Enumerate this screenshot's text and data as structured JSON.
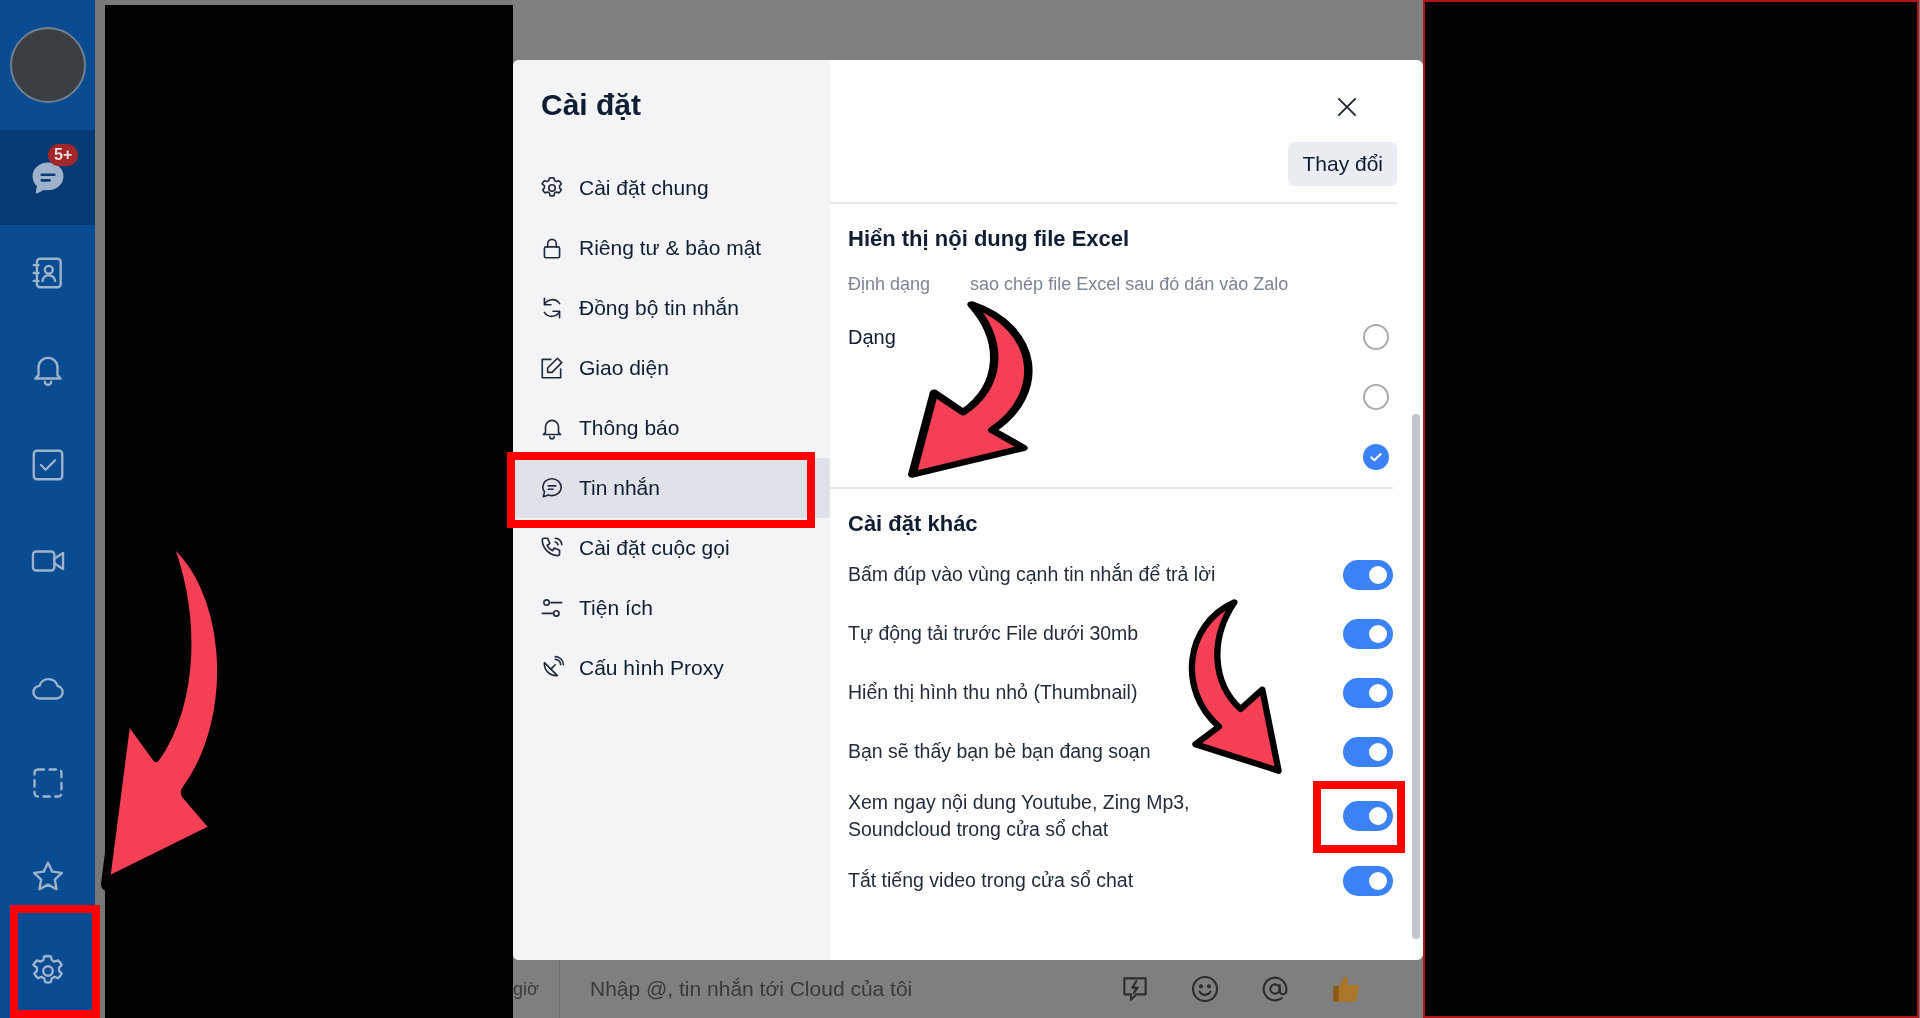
{
  "nav": {
    "badge": "5+",
    "items": [
      {
        "kind": "chat",
        "selected": true
      },
      {
        "kind": "contacts",
        "selected": false
      },
      {
        "kind": "bell",
        "selected": false
      },
      {
        "kind": "todo",
        "selected": false
      },
      {
        "kind": "video",
        "selected": false
      }
    ],
    "bottom_items": [
      {
        "kind": "cloud",
        "selected": false
      },
      {
        "kind": "dashed",
        "selected": false
      },
      {
        "kind": "star",
        "selected": false
      },
      {
        "kind": "gear",
        "selected": false
      }
    ]
  },
  "chat": {
    "time_fragment": "giờ",
    "composer_placeholder": "Nhập @, tin nhắn tới Cloud của tôi"
  },
  "settings": {
    "title": "Cài đặt",
    "menu": [
      {
        "label": "Cài đặt chung",
        "kind": "gear",
        "selected": false
      },
      {
        "label": "Riêng tư & bảo mật",
        "kind": "lock",
        "selected": false
      },
      {
        "label": "Đồng bộ tin nhắn",
        "kind": "sync",
        "selected": false
      },
      {
        "label": "Giao diện",
        "kind": "edit",
        "selected": false
      },
      {
        "label": "Thông báo",
        "kind": "bell",
        "selected": false
      },
      {
        "label": "Tin nhắn",
        "kind": "chat",
        "selected": true
      },
      {
        "label": "Cài đặt cuộc gọi",
        "kind": "phone",
        "selected": false
      },
      {
        "label": "Tiện ích",
        "kind": "sliders",
        "selected": false
      },
      {
        "label": "Cấu hình Proxy",
        "kind": "satellite",
        "selected": false
      }
    ],
    "change_button": "Thay đổi",
    "excel": {
      "title": "Hiển thị nội dung file Excel",
      "description_parts": [
        "Định dạng",
        "sao chép file Excel sau đó dán vào Zalo"
      ],
      "options": [
        {
          "label": "Dạng",
          "selected": false
        },
        {
          "selected": false
        },
        {
          "selected": true
        }
      ]
    },
    "other": {
      "title": "Cài đặt khác",
      "toggles": [
        {
          "label": "Bấm đúp vào vùng cạnh tin nhắn để trả lời",
          "on": true
        },
        {
          "label": "Tự động tải trước File dưới 30mb",
          "on": true
        },
        {
          "label": "Hiển thị hình thu nhỏ (Thumbnail)",
          "on": true
        },
        {
          "label": "Bạn sẽ thấy bạn bè bạn đang soạn",
          "on": true
        },
        {
          "label": "Xem ngay nội dung Youtube, Zing Mp3, Soundcloud trong cửa sổ chat",
          "on": true
        },
        {
          "label": "Tắt tiếng video trong cửa sổ chat",
          "on": true
        }
      ]
    }
  }
}
